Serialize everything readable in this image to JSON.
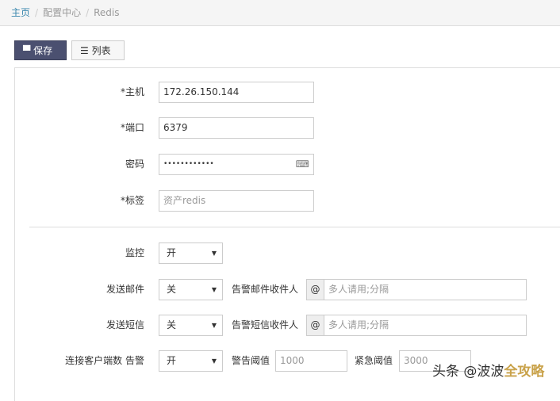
{
  "breadcrumb": {
    "home": "主页",
    "config": "配置中心",
    "current": "Redis"
  },
  "toolbar": {
    "save": "保存",
    "list": "列表"
  },
  "form": {
    "host": {
      "label": "*主机",
      "value": "172.26.150.144"
    },
    "port": {
      "label": "*端口",
      "value": "6379"
    },
    "password": {
      "label": "密码",
      "value": "••••••••••••"
    },
    "tag": {
      "label": "*标签",
      "placeholder": "资产redis"
    },
    "monitor": {
      "label": "监控",
      "value": "开"
    },
    "email": {
      "label": "发送邮件",
      "value": "关",
      "recipient_label": "告警邮件收件人",
      "addon": "@",
      "placeholder": "多人请用;分隔"
    },
    "sms": {
      "label": "发送短信",
      "value": "关",
      "recipient_label": "告警短信收件人",
      "addon": "@",
      "placeholder": "多人请用;分隔"
    },
    "clients": {
      "label": "连接客户端数 告警",
      "value": "开",
      "warn_label": "警告阈值",
      "warn_value": "1000",
      "crit_label": "紧急阈值",
      "crit_value": "3000"
    }
  },
  "watermark": {
    "text": "头条 @波波",
    "highlight": "全攻略"
  }
}
